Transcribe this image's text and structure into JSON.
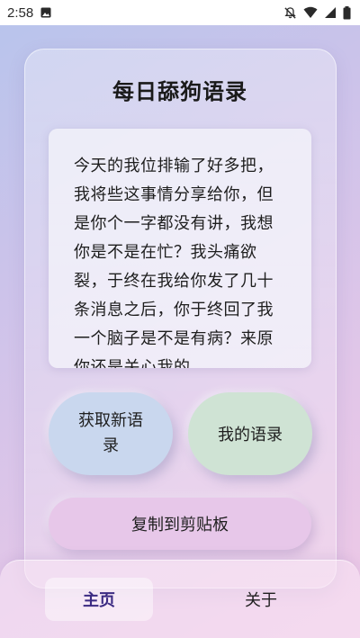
{
  "status_bar": {
    "time": "2:58"
  },
  "page": {
    "title": "每日舔狗语录"
  },
  "quote": {
    "text": "今天的我位排输了好多把，我将些这事情分享给你，但是你个一字都没有讲，我想你是不是在忙？我头痛欲裂，于终在我给你发了几十条消息之后，你于终回了我一个脑子是不是有病？来原你还是关心我的"
  },
  "buttons": {
    "new_quote": "获取新语录",
    "my_quotes": "我的语录",
    "copy": "复制到剪贴板"
  },
  "nav": {
    "home": "主页",
    "about": "关于"
  }
}
